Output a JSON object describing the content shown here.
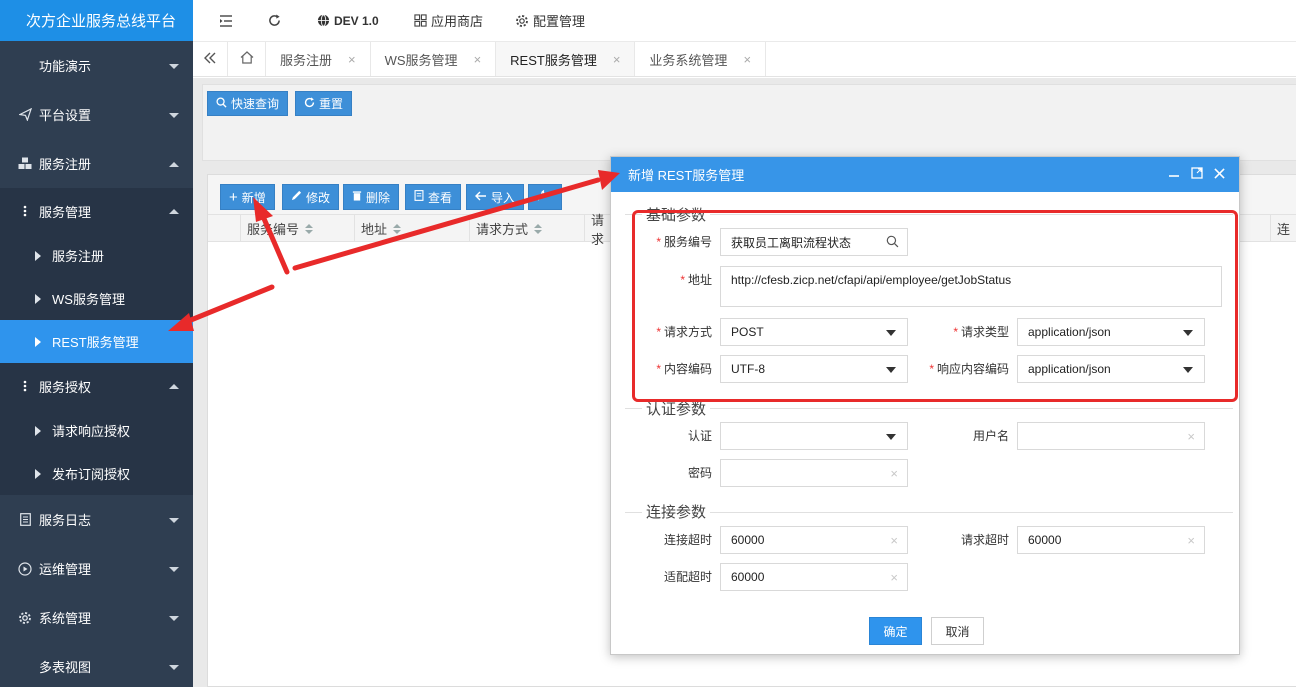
{
  "app": {
    "title": "次方企业服务总线平台"
  },
  "topbar": {
    "env": "DEV 1.0",
    "app_store": "应用商店",
    "config": "配置管理"
  },
  "sidebar": {
    "items": [
      {
        "label": "功能演示"
      },
      {
        "label": "平台设置"
      },
      {
        "label": "服务注册"
      },
      {
        "label": "服务管理"
      },
      {
        "label": "服务注册"
      },
      {
        "label": "WS服务管理"
      },
      {
        "label": "REST服务管理"
      },
      {
        "label": "服务授权"
      },
      {
        "label": "请求响应授权"
      },
      {
        "label": "发布订阅授权"
      },
      {
        "label": "服务日志"
      },
      {
        "label": "运维管理"
      },
      {
        "label": "系统管理"
      },
      {
        "label": "多表视图"
      }
    ]
  },
  "tabs": [
    {
      "label": "服务注册"
    },
    {
      "label": "WS服务管理"
    },
    {
      "label": "REST服务管理"
    },
    {
      "label": "业务系统管理"
    }
  ],
  "search": {
    "quick": "快速查询",
    "reset": "重置"
  },
  "grid": {
    "toolbar": {
      "add": "新增",
      "edit": "修改",
      "delete": "删除",
      "view": "查看",
      "import": "导入"
    },
    "columns": [
      "服务编号",
      "地址",
      "请求方式",
      "请求",
      "连"
    ]
  },
  "dialog": {
    "title": "新增 REST服务管理",
    "basic": {
      "legend": "基础参数",
      "service_code_label": "服务编号",
      "service_code_value": "获取员工离职流程状态",
      "address_label": "地址",
      "address_value": "http://cfesb.zicp.net/cfapi/api/employee/getJobStatus",
      "method_label": "请求方式",
      "method_value": "POST",
      "req_type_label": "请求类型",
      "req_type_value": "application/json",
      "encoding_label": "内容编码",
      "encoding_value": "UTF-8",
      "resp_type_label": "响应内容编码",
      "resp_type_value": "application/json"
    },
    "auth": {
      "legend": "认证参数",
      "auth_label": "认证",
      "auth_value": "",
      "username_label": "用户名",
      "username_value": "",
      "password_label": "密码",
      "password_value": ""
    },
    "conn": {
      "legend": "连接参数",
      "conn_timeout_label": "连接超时",
      "conn_timeout_value": "60000",
      "req_timeout_label": "请求超时",
      "req_timeout_value": "60000",
      "adapt_timeout_label": "适配超时",
      "adapt_timeout_value": "60000"
    },
    "ok": "确定",
    "cancel": "取消"
  },
  "colors": {
    "accent": "#2f94ed",
    "sidebar": "#2f3e51",
    "annotation": "#e82a2a"
  }
}
